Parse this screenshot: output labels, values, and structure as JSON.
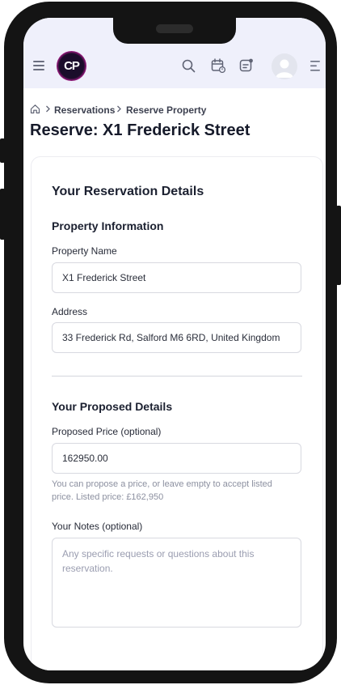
{
  "header": {
    "menu_icon": "hamburger-icon",
    "logo_text": "CP",
    "icons": [
      "search-icon",
      "calendar-icon",
      "message-icon",
      "avatar-icon",
      "menu-right-icon"
    ]
  },
  "breadcrumb": {
    "home_icon": "home-icon",
    "items": [
      "Reservations",
      "Reserve Property"
    ]
  },
  "page": {
    "title": "Reserve: X1 Frederick Street"
  },
  "form": {
    "heading": "Your Reservation Details",
    "property_section": "Property Information",
    "property_name_label": "Property Name",
    "property_name_value": "X1 Frederick Street",
    "address_label": "Address",
    "address_value": "33 Frederick Rd, Salford M6 6RD, United Kingdom",
    "proposed_section": "Your Proposed Details",
    "price_label": "Proposed Price (optional)",
    "price_value": "162950.00",
    "price_help": "You can propose a price, or leave empty to accept listed price. Listed price: £162,950",
    "notes_label": "Your Notes (optional)",
    "notes_placeholder": "Any specific requests or questions about this reservation."
  },
  "colors": {
    "topbar_bg": "#eff0fb",
    "text_dark": "#161a2a",
    "help_text": "#8c90a0"
  }
}
